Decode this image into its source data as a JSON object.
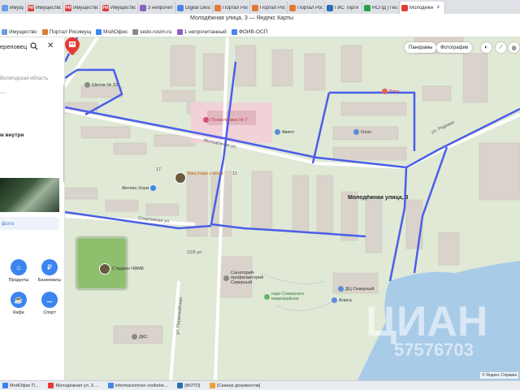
{
  "browser": {
    "tabs": [
      {
        "label": "Имущество",
        "icon": "globe-icon",
        "color": "#6aa0e0",
        "badge": ""
      },
      {
        "label": "Имущество",
        "icon": "rosim-icon",
        "color": "#d93b3b",
        "badge": "РИ"
      },
      {
        "label": "Имущество",
        "icon": "rosim-icon",
        "color": "#d93b3b",
        "badge": "РИ"
      },
      {
        "label": "Имущество",
        "icon": "rosim-icon",
        "color": "#d93b3b",
        "badge": "РИ"
      },
      {
        "label": "3 непрочитан",
        "icon": "mail-icon",
        "color": "#8b5fc8",
        "badge": ""
      },
      {
        "label": "Digital Desc",
        "icon": "doc-icon",
        "color": "#4a86e8",
        "badge": ""
      },
      {
        "label": "Портал Росс",
        "icon": "portal-icon",
        "color": "#e07a3a",
        "badge": ""
      },
      {
        "label": "Портал Росс",
        "icon": "portal-icon",
        "color": "#e07a3a",
        "badge": ""
      },
      {
        "label": "Портал Росс",
        "icon": "portal-icon",
        "color": "#e07a3a",
        "badge": ""
      },
      {
        "label": "ГИС Торги",
        "icon": "gis-icon",
        "color": "#2a6fb5",
        "badge": ""
      },
      {
        "label": "НСПД | Геос",
        "icon": "nspd-icon",
        "color": "#2aa04a",
        "badge": ""
      },
      {
        "label": "Молодёжн",
        "icon": "map-pin-icon",
        "color": "#e53935",
        "badge": ""
      }
    ],
    "window_title": "Молодёжная улица, 3 — Яндекс Карты",
    "bookmarks": [
      {
        "label": "Имущество",
        "color": "#6aa0e0"
      },
      {
        "label": "Портал Росимущ",
        "color": "#e07a3a"
      },
      {
        "label": "МойОфис",
        "color": "#3b85f0"
      },
      {
        "label": "sedo.rosim.ru",
        "color": "#888888"
      },
      {
        "label": "1 непрочитанный",
        "color": "#8b5fc8"
      },
      {
        "label": "ФОИВ-ОСП",
        "color": "#4a86e8"
      }
    ]
  },
  "sidebar": {
    "search_text": "ереповец",
    "region": "Вологодская область",
    "dots": "···",
    "inside": "м внутри",
    "photo_button": "фото",
    "categories": [
      {
        "label": "Продукты",
        "icon": "basket-icon",
        "glyph": "⌂"
      },
      {
        "label": "Банкоматы",
        "icon": "ruble-icon",
        "glyph": "₽"
      },
      {
        "label": "Кафе",
        "icon": "cup-icon",
        "glyph": "☕"
      },
      {
        "label": "Спорт",
        "icon": "dumbbell-icon",
        "glyph": "⚊"
      }
    ]
  },
  "map": {
    "buttons": {
      "panoramas": "Панорамы",
      "photos": "Фотографии"
    },
    "marker_label": "Молодёжная улица, 3",
    "labels": {
      "school": "Школа № 33",
      "polyclinic": "Поликлиника № 7",
      "avito": "Авито",
      "ozon": "Ozon",
      "vita": "Вита",
      "fitness": "Фитнес Хоум",
      "stadium": "Стадион ЧФМК",
      "sanatorium": "Санаторий-профилакторий Северный",
      "park": "парк Северного микрорайона",
      "dts": "ДЦ Северный",
      "alisa": "Алиса",
      "dks": "ДКС",
      "street_molodezhnaya": "Молодёжная ул.",
      "street_sportivnaya": "Спортивная ул.",
      "street_ryadovaya": "ул. Рядовая",
      "street_pervomayskaya": "ул. Первомайская",
      "house_17": "17",
      "house_11": "11",
      "house_225": "22/5 ул.",
      "poi_story": "Ваш отзыв о месте"
    },
    "watermark": "ЦИАН",
    "watermark_id": "57576703",
    "copyright": "© Яндекс  Справка"
  },
  "taskbar": [
    {
      "label": "МойОфис П...",
      "color": "#3b85f0"
    },
    {
      "label": "Молодёжная ул. 3 ...",
      "color": "#e53935"
    },
    {
      "label": "informacionnoe soobshe...",
      "color": "#4a86e8"
    },
    {
      "label": "[ФОТО]",
      "color": "#2a6fb5"
    },
    {
      "label": "[Сканер документов]",
      "color": "#f0a030"
    }
  ]
}
